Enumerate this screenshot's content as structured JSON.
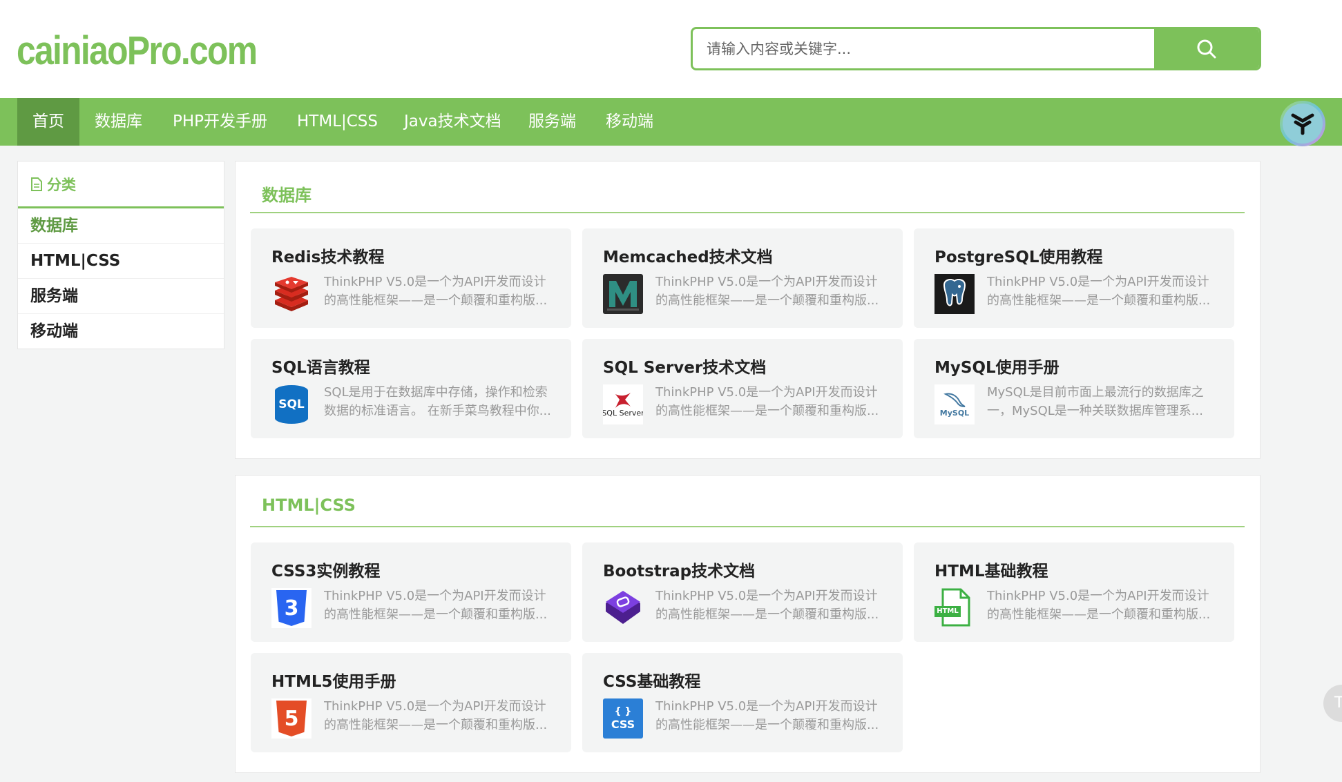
{
  "header": {
    "logo": "cainiaoPro.com",
    "search_placeholder": "请输入内容或关键字..."
  },
  "nav": {
    "items": [
      {
        "label": "首页",
        "active": true
      },
      {
        "label": "数据库"
      },
      {
        "label": "PHP开发手册"
      },
      {
        "label": "HTML|CSS"
      },
      {
        "label": "Java技术文档"
      },
      {
        "label": "服务端"
      },
      {
        "label": "移动端"
      }
    ]
  },
  "sidebar": {
    "title": "分类",
    "items": [
      {
        "label": "数据库",
        "active": true
      },
      {
        "label": "HTML|CSS"
      },
      {
        "label": "服务端"
      },
      {
        "label": "移动端"
      }
    ]
  },
  "sections": [
    {
      "title": "数据库",
      "cards": [
        {
          "title": "Redis技术教程",
          "desc1": "ThinkPHP V5.0是一个为API开发而设计",
          "desc2": "的高性能框架——是一个颠覆和重构版...",
          "icon": "redis-icon"
        },
        {
          "title": "Memcached技术文档",
          "desc1": "ThinkPHP V5.0是一个为API开发而设计",
          "desc2": "的高性能框架——是一个颠覆和重构版...",
          "icon": "memcached-icon"
        },
        {
          "title": "PostgreSQL使用教程",
          "desc1": "ThinkPHP V5.0是一个为API开发而设计",
          "desc2": "的高性能框架——是一个颠覆和重构版...",
          "icon": "postgresql-icon"
        },
        {
          "title": "SQL语言教程",
          "desc1": "SQL是用于在数据库中存储，操作和检索",
          "desc2": "数据的标准语言。 在新手菜鸟教程中你...",
          "icon": "sql-icon",
          "icon_text": "SQL"
        },
        {
          "title": "SQL Server技术文档",
          "desc1": "ThinkPHP V5.0是一个为API开发而设计",
          "desc2": "的高性能框架——是一个颠覆和重构版...",
          "icon": "sqlserver-icon",
          "icon_text": "SQL Server"
        },
        {
          "title": "MySQL使用手册",
          "desc1": "MySQL是目前市面上最流行的数据库之",
          "desc2": "一，MySQL是一种关联数据库管理系...",
          "icon": "mysql-icon",
          "icon_text": "MySQL"
        }
      ]
    },
    {
      "title": "HTML|CSS",
      "cards": [
        {
          "title": "CSS3实例教程",
          "desc1": "ThinkPHP V5.0是一个为API开发而设计",
          "desc2": "的高性能框架——是一个颠覆和重构版...",
          "icon": "css3-icon",
          "icon_text": "3"
        },
        {
          "title": "Bootstrap技术文档",
          "desc1": "ThinkPHP V5.0是一个为API开发而设计",
          "desc2": "的高性能框架——是一个颠覆和重构版...",
          "icon": "bootstrap-icon"
        },
        {
          "title": "HTML基础教程",
          "desc1": "ThinkPHP V5.0是一个为API开发而设计",
          "desc2": "的高性能框架——是一个颠覆和重构版...",
          "icon": "html-file-icon",
          "icon_text": "HTML"
        },
        {
          "title": "HTML5使用手册",
          "desc1": "ThinkPHP V5.0是一个为API开发而设计",
          "desc2": "的高性能框架——是一个颠覆和重构版...",
          "icon": "html5-icon",
          "icon_text": "5"
        },
        {
          "title": "CSS基础教程",
          "desc1": "ThinkPHP V5.0是一个为API开发而设计",
          "desc2": "的高性能框架——是一个颠覆和重构版...",
          "icon": "css-icon",
          "icon_text": "{ }",
          "icon_text2": "CSS"
        }
      ]
    }
  ],
  "back_to_top": "T",
  "colors": {
    "brand": "#7dc15a",
    "nav_active": "#5f9a43",
    "page_bg": "#f3f4f4"
  }
}
